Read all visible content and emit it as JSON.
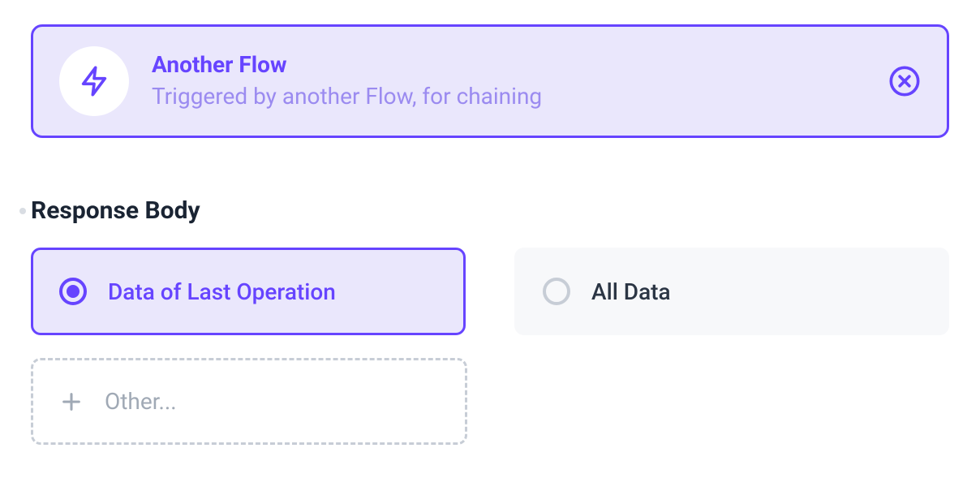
{
  "trigger": {
    "title": "Another Flow",
    "subtitle": "Triggered by another Flow, for chaining"
  },
  "section": {
    "title": "Response Body"
  },
  "options": {
    "selected": {
      "label": "Data of Last Operation"
    },
    "unselected": {
      "label": "All Data"
    },
    "other": {
      "label": "Other..."
    }
  }
}
